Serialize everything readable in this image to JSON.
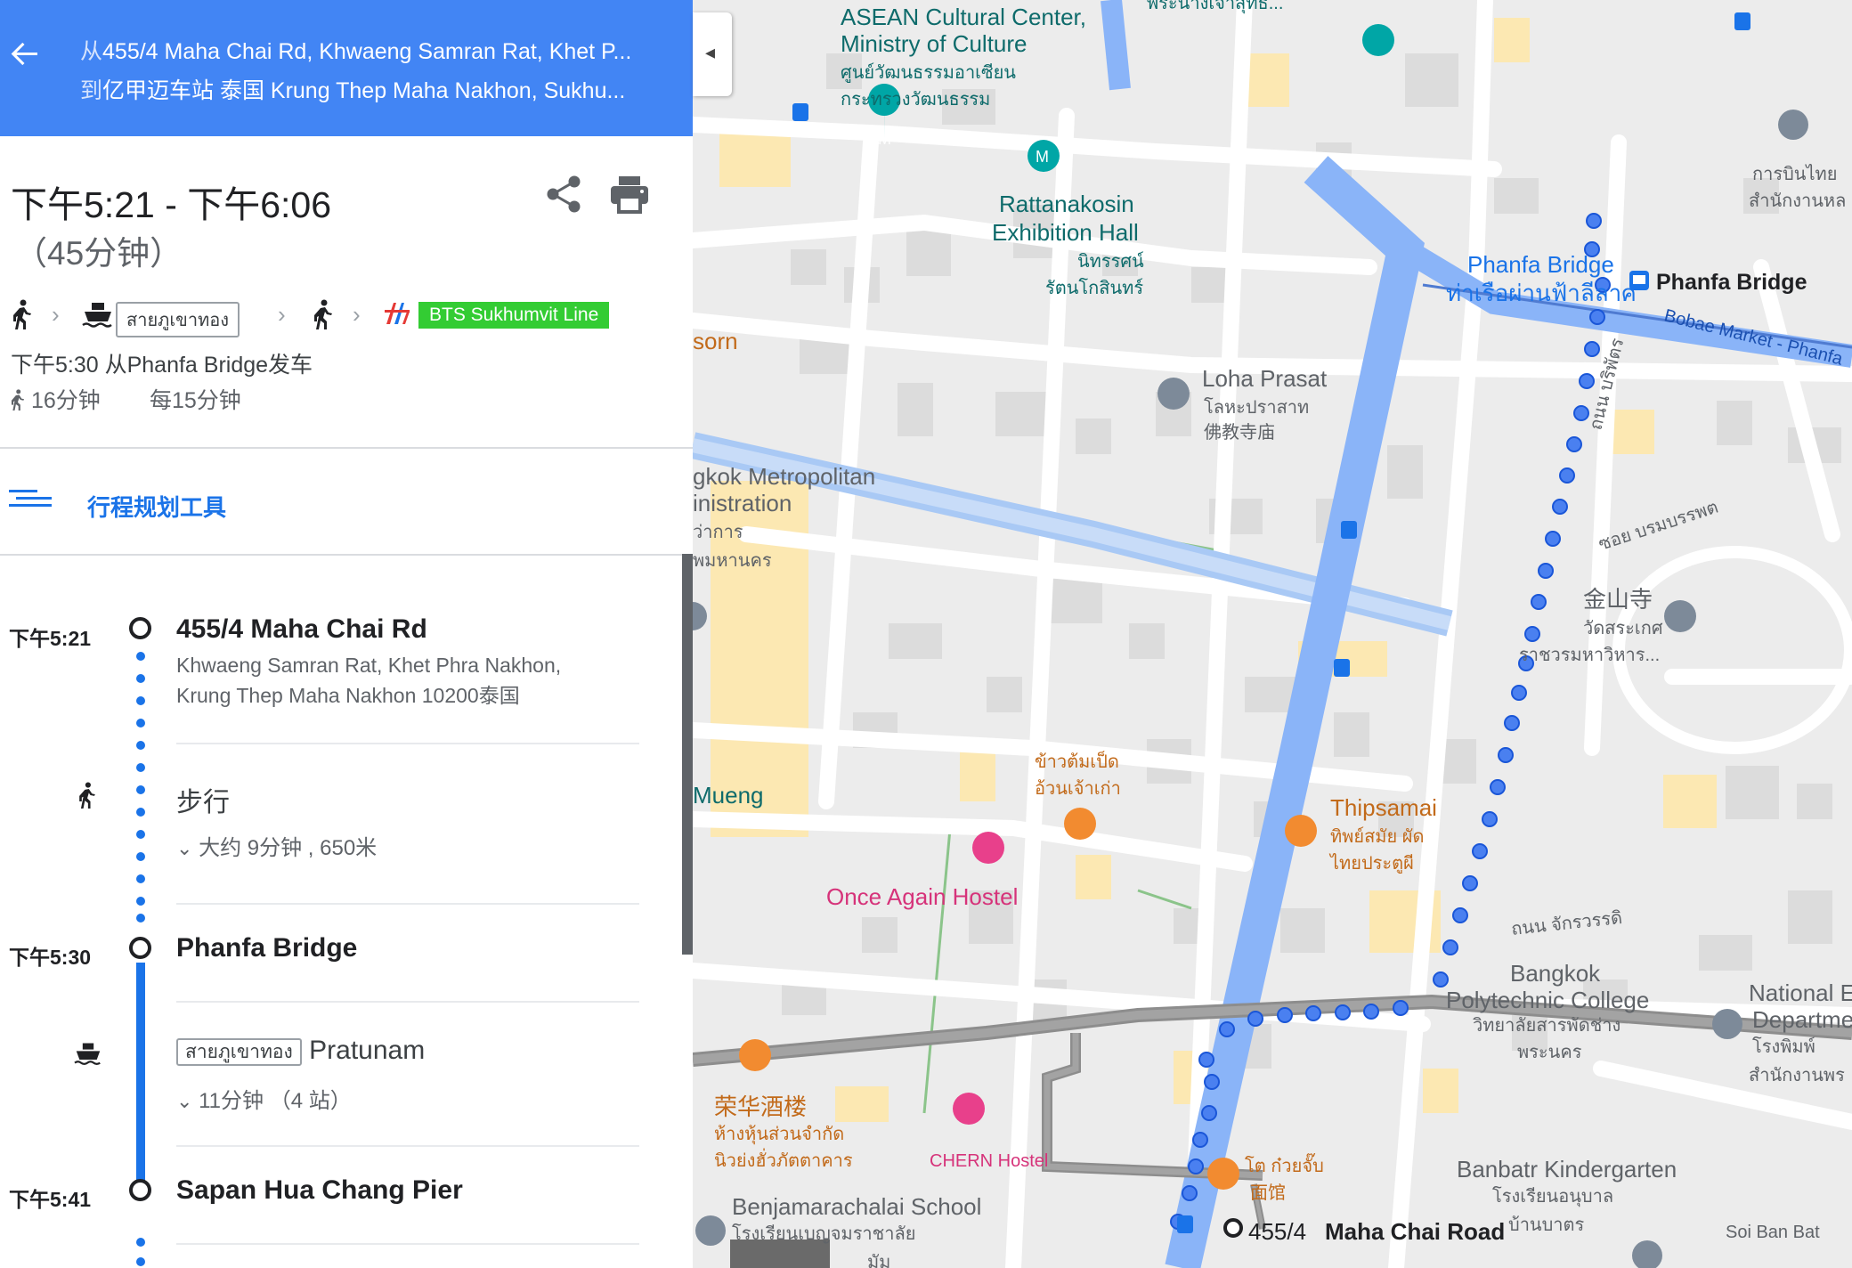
{
  "header": {
    "from_prefix": "从",
    "from_text": "455/4 Maha Chai Rd, Khwaeng Samran Rat, Khet P...",
    "to_prefix": "到",
    "to_text": "亿甲迈车站 泰国 Krung Thep Maha Nakhon, Sukhu..."
  },
  "summary": {
    "time_range": "下午5:21 - 下午6:06",
    "duration": "（45分钟）",
    "boat_line": "สายภูเขาทอง",
    "bts_line": "BTS Sukhumvit Line",
    "depart_text": "下午5:30 从Phanfa Bridge发车",
    "walk_total": "16分钟",
    "frequency": "每15分钟"
  },
  "trip_planner_label": "行程规划工具",
  "colors": {
    "header": "#4285f4",
    "bts": "#33cc33",
    "route_blue": "#1a73e8",
    "water": "#8ab4f8"
  },
  "steps": [
    {
      "time": "下午5:21",
      "name": "455/4 Maha Chai Rd",
      "addr1": "Khwaeng Samran Rat, Khet Phra Nakhon,",
      "addr2": "Krung Thep Maha Nakhon 10200泰国"
    },
    {
      "mode": "步行",
      "detail": "大约 9分钟 , 650米"
    },
    {
      "time": "下午5:30",
      "name": "Phanfa Bridge"
    },
    {
      "line": "สายภูเขาทอง",
      "dest": "Pratunam",
      "detail": "11分钟 （4 站）"
    },
    {
      "time": "下午5:41",
      "name": "Sapan Hua Chang Pier"
    }
  ],
  "map": {
    "labels": {
      "asean1": "ASEAN Cultural Center,",
      "asean2": "Ministry of Culture",
      "asean_th1": "ศูนย์วัฒนธรรมอาเซียน",
      "asean_th2": "กระทรวงวัฒนธรรม",
      "top_th": "พระนางเจ้าสุทธิ...",
      "ratt1": "Rattanakosin",
      "ratt2": "Exhibition Hall",
      "ratt_th1": "นิทรรศน์",
      "ratt_th2": "รัตนโกสินทร์",
      "loha": "Loha Prasat",
      "loha_th": "โลหะปราสาท",
      "loha_cn": "佛教寺庙",
      "phanfa_en": "Phanfa Bridge",
      "phanfa_th": "ท่าเรือผ่านฟ้าลีลาศ",
      "phanfa_stop": "Phanfa Bridge",
      "bobae": "Bobae Market - Phanfa",
      "airline1": "การบินไทย",
      "airline2": "สำนักงานหล",
      "bma1": "gkok Metropolitan",
      "bma2": "inistration",
      "bma3": "ว่าการ",
      "bma4": "พมหานคร",
      "sorn": "sorn",
      "jinshan": "金山寺",
      "wat1": "วัดสระเกศ",
      "wat2": "ราชวรมหาวิหาร...",
      "soi": "ซอย บรมบรรพต",
      "kai_th1": "ข้าวต้มเป็ด",
      "kai_th2": "อ้วนเจ้าเก่า",
      "mueng": "Mueng",
      "thipsamai": "Thipsamai",
      "thip_th1": "ทิพย์สมัย ผัด",
      "thip_th2": "ไทยประตูผี",
      "once": "Once Again Hostel",
      "chakkra": "ถนน จักรวรรดิ",
      "poly1": "Bangkok",
      "poly2": "Polytechnic College",
      "poly_th1": "วิทยาลัยสารพัดช่าง",
      "poly_th2": "พระนคร",
      "nat1": "National E",
      "nat2": "Departme",
      "nat_th1": "โรงพิมพ์",
      "nat_th2": "สำนักงานพร",
      "ronghua": "荣华酒楼",
      "ronghua_th1": "ห้างหุ้นส่วนจำกัด",
      "ronghua_th2": "นิวย่งฮั่วภัตตาคาร",
      "chern": "CHERN Hostel",
      "noodle_th": "โต ก๋วยจั๊บ",
      "noodle_cn": "面馆",
      "bench": "Benjamarachalai School",
      "bench_th": "โรงเรียนเบญจมราชาลัย",
      "banbatr1": "Banbatr Kindergarten",
      "banbatr_th1": "โรงเรียนอนุบาล",
      "banbatr_th2": "บ้านบาตร",
      "soiban": "Soi Ban Bat",
      "dest_num": "455/4",
      "dest_name": "Maha Chai Road",
      "vert_road": "ถนน บริพัตร",
      "ment": "มัม"
    }
  }
}
